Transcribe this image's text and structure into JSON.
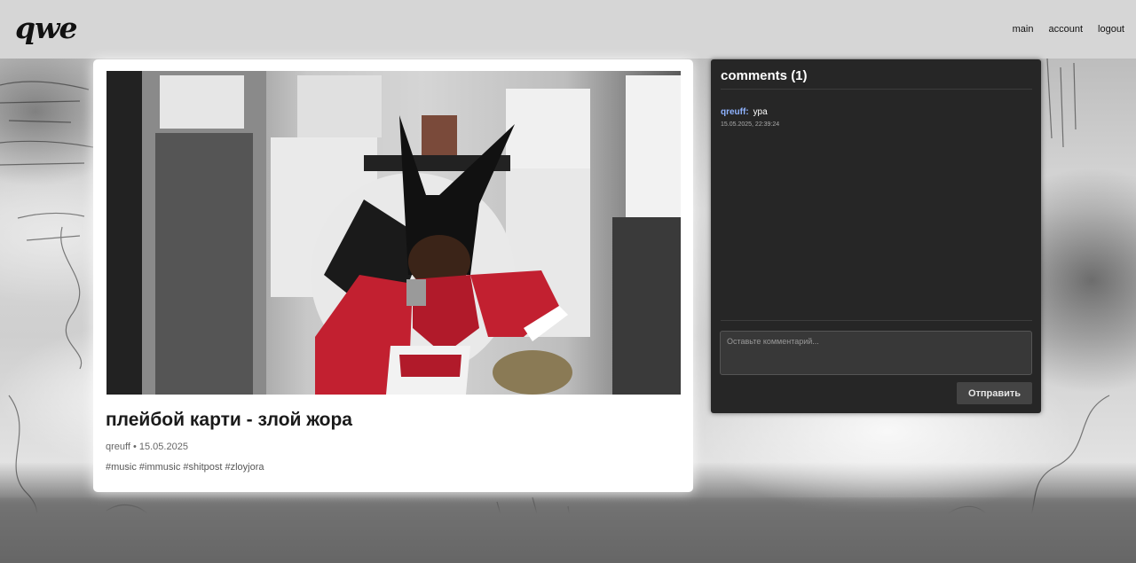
{
  "header": {
    "logo": "qwe",
    "nav": [
      "main",
      "account",
      "logout"
    ]
  },
  "post": {
    "title": "плейбой карти - злой жора",
    "meta": "qreuff • 15.05.2025",
    "tags": "#music #immusic #shitpost #zloyjora"
  },
  "comments": {
    "title": "comments (1)",
    "items": [
      {
        "author": "qreuff:",
        "text": "ура",
        "time": "15.05.2025, 22:39:24"
      }
    ],
    "input_placeholder": "Оставьте комментарий...",
    "send_label": "Отправить"
  },
  "colors": {
    "header_bg": "#d6d6d6",
    "panel_bg": "#262626",
    "author": "#8fb3ff"
  }
}
